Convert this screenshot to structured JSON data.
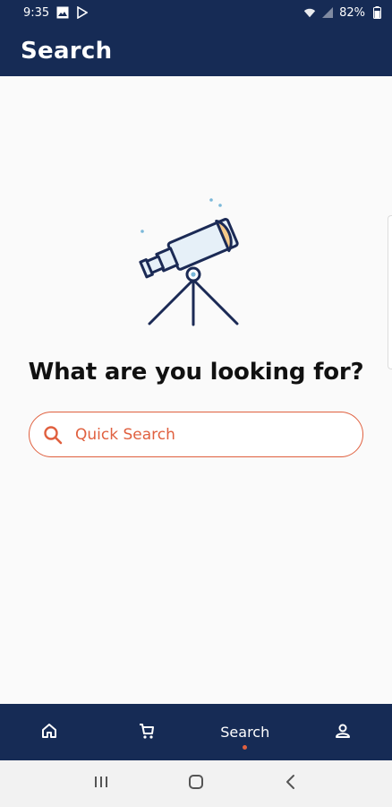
{
  "status_bar": {
    "time": "9:35",
    "battery": "82%",
    "icons": [
      "gallery-icon",
      "play-store-icon",
      "wifi-icon",
      "signal-icon",
      "battery-icon"
    ]
  },
  "app_bar": {
    "title": "Search"
  },
  "main": {
    "illustration": "telescope-icon",
    "headline": "What are you looking for?",
    "search": {
      "placeholder": "Quick Search",
      "value": ""
    }
  },
  "bottom_nav": {
    "items": [
      {
        "icon": "home-icon",
        "label": ""
      },
      {
        "icon": "cart-icon",
        "label": ""
      },
      {
        "icon": "search",
        "label": "Search",
        "active": true
      },
      {
        "icon": "account-icon",
        "label": ""
      }
    ]
  },
  "system_nav": {
    "buttons": [
      "recents-icon",
      "home-circle-icon",
      "back-icon"
    ]
  },
  "colors": {
    "primary": "#162b55",
    "accent": "#e0603f",
    "background": "#fafafa"
  }
}
